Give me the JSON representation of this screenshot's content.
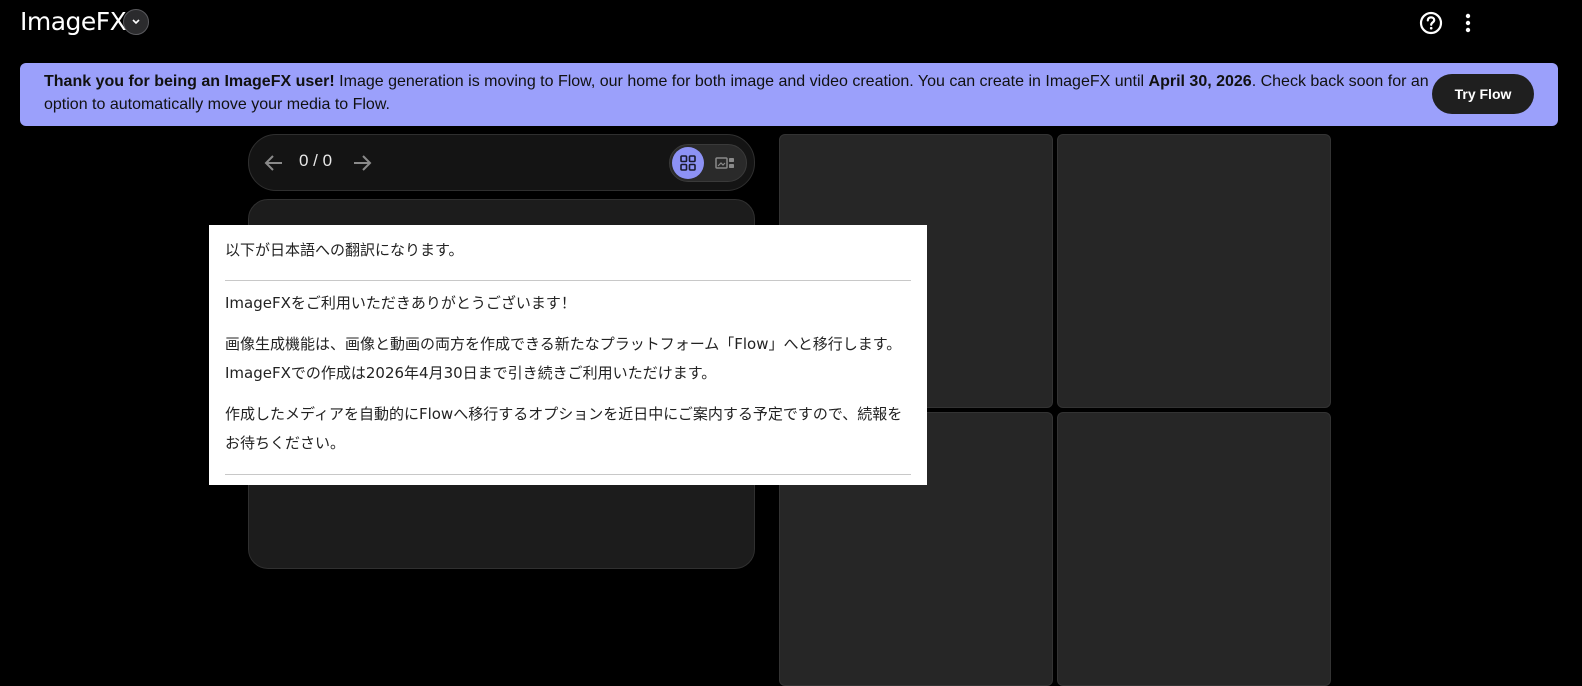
{
  "app": {
    "title": "ImageFX"
  },
  "header": {
    "help_icon": "help-circle-icon",
    "more_icon": "more-vert-icon"
  },
  "banner": {
    "bold_lead": "Thank you for being an ImageFX user!",
    "text_part1": " Image generation is moving to Flow, our home for both image and video creation. You can create in ImageFX until ",
    "bold_date": "April 30, 2026",
    "text_part2": ". Check back soon for an option to automatically move your media to Flow.",
    "button_label": "Try Flow",
    "background_color": "#9ba0fb"
  },
  "pager": {
    "count": "0 / 0",
    "prev_icon": "arrow-left-icon",
    "next_icon": "arrow-right-icon"
  },
  "view_toggle": {
    "grid_icon": "grid-view-icon",
    "single_icon": "single-view-icon",
    "active": "grid",
    "accent_color": "#8d92f5"
  },
  "translation_popup": {
    "heading": "以下が日本語への翻訳になります。",
    "paragraphs": [
      "ImageFXをご利用いただきありがとうございます！",
      "画像生成機能は、画像と動画の両方を作成できる新たなプラットフォーム「Flow」へと移行します。ImageFXでの作成は2026年4月30日まで引き続きご利用いただけます。",
      "作成したメディアを自動的にFlowへ移行するオプションを近日中にご案内する予定ですので、続報をお待ちください。"
    ]
  }
}
